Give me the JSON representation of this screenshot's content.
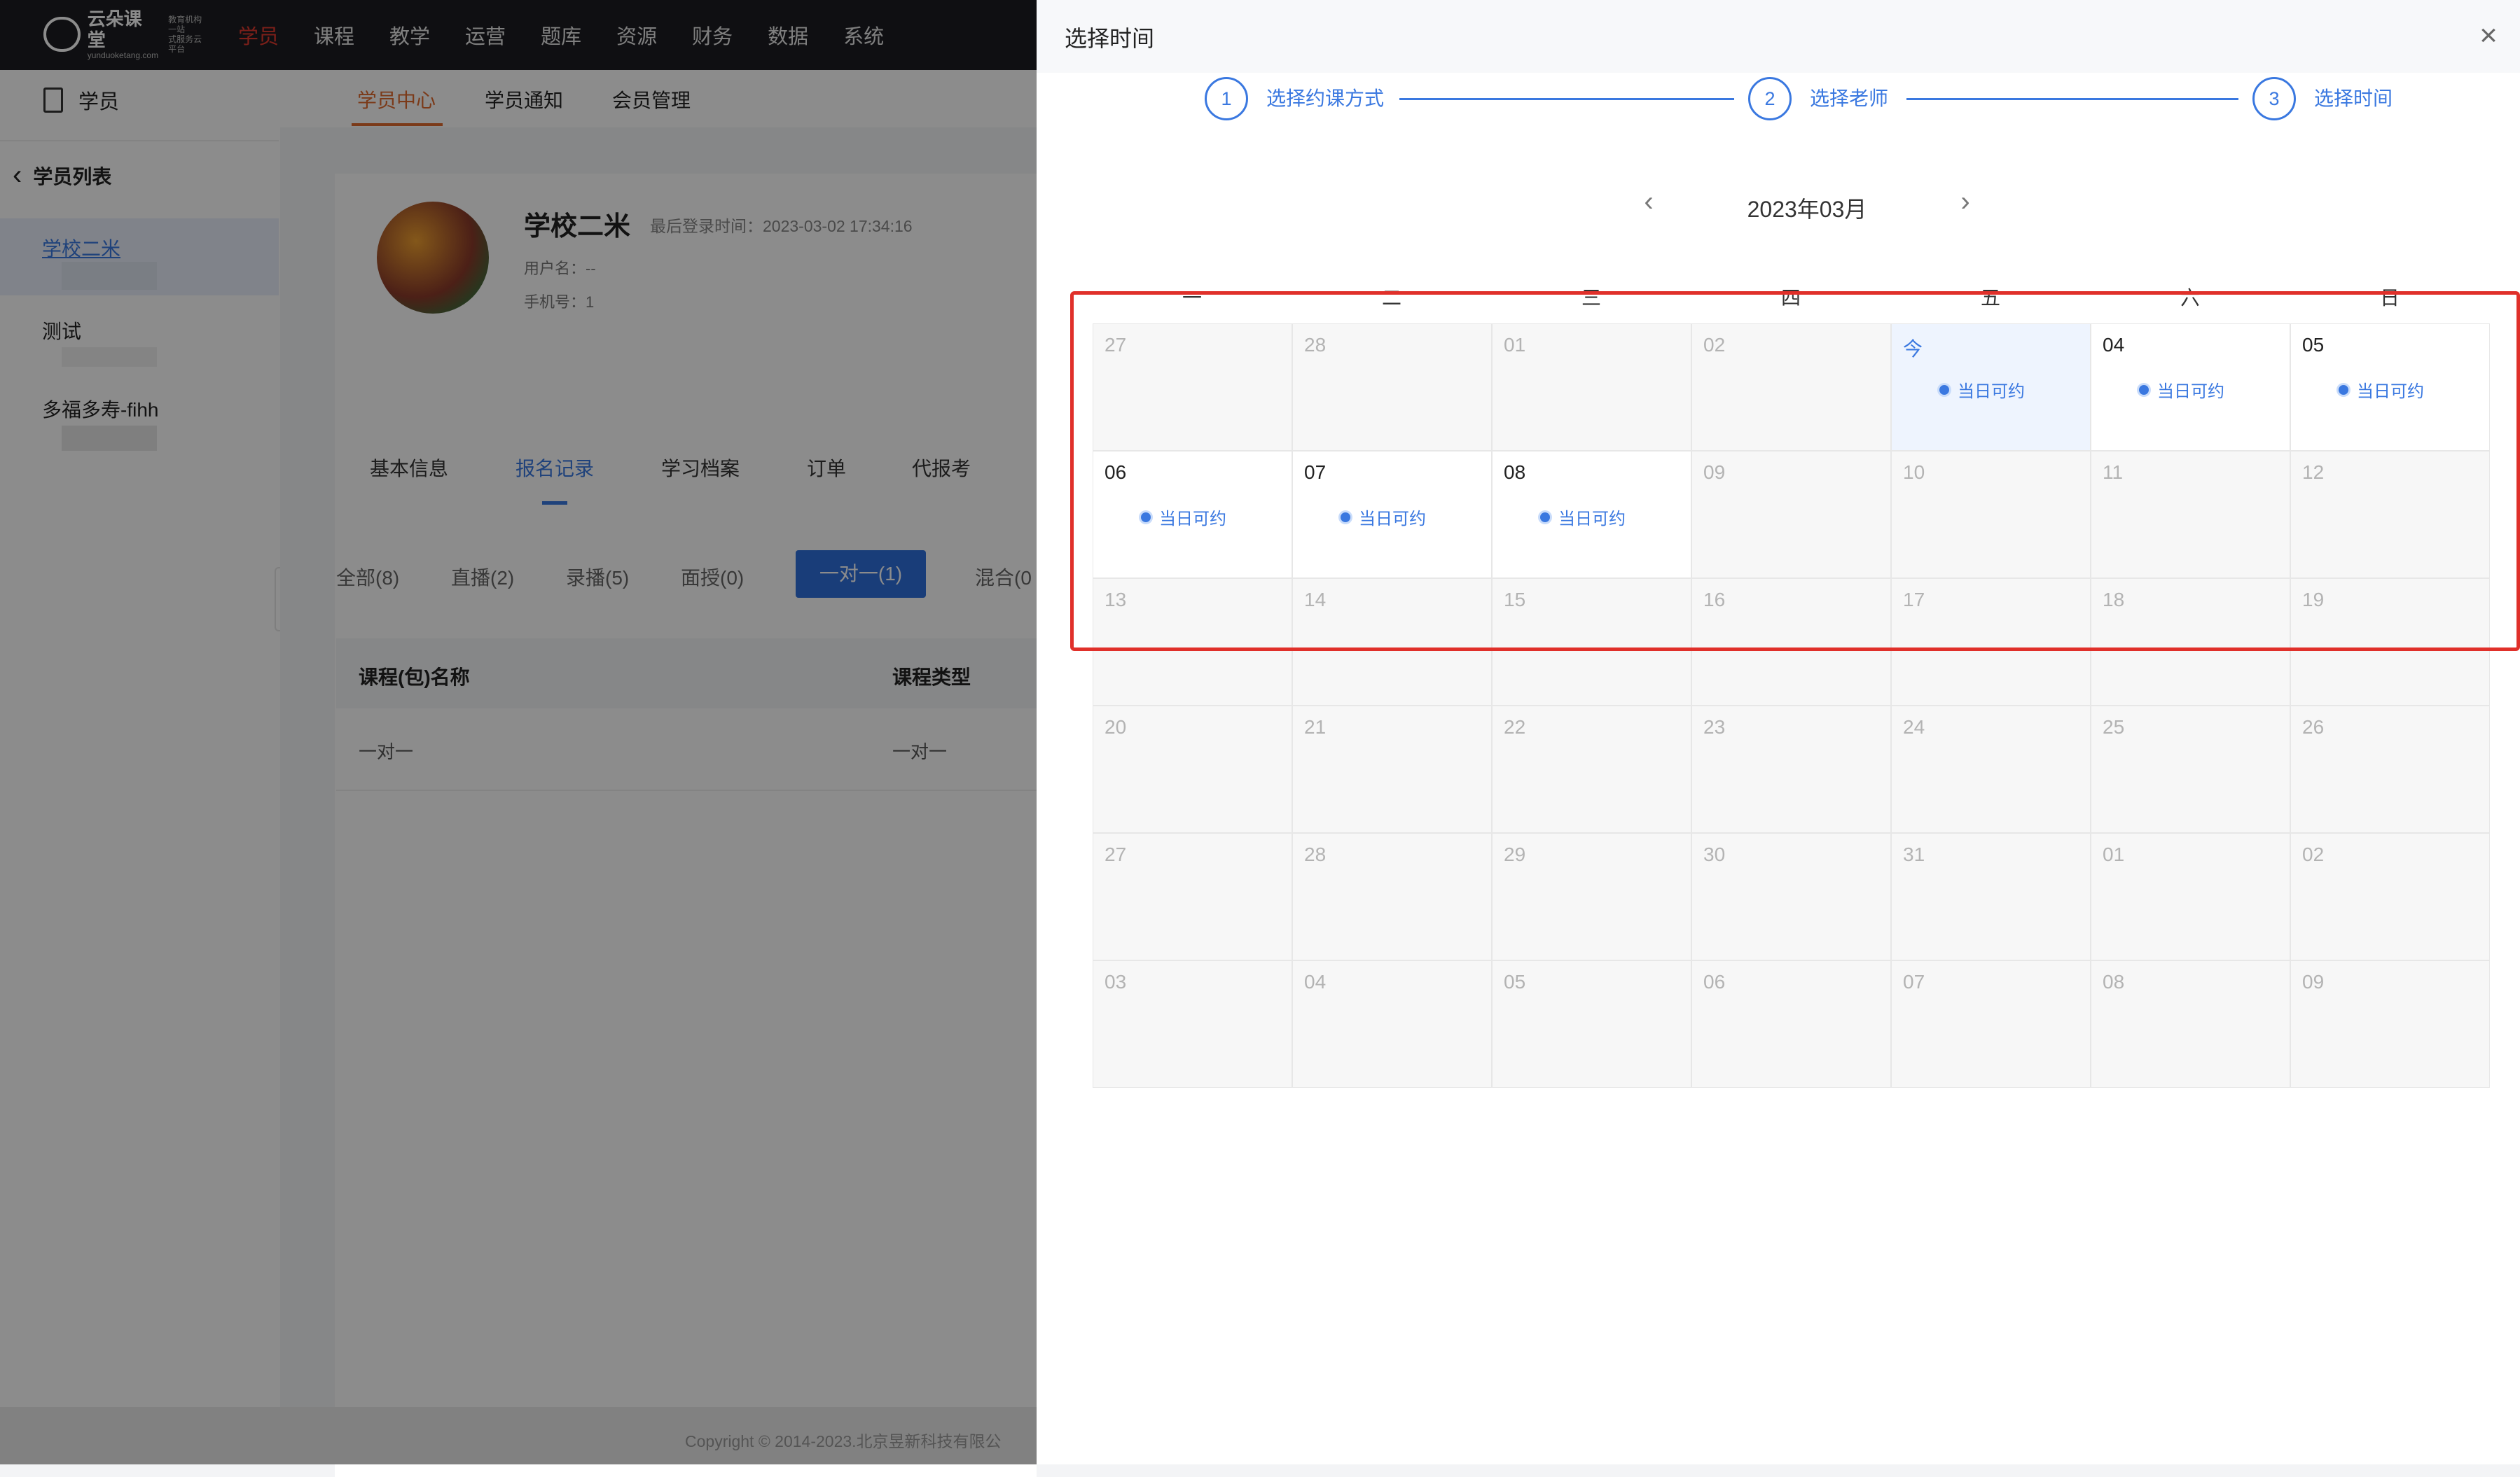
{
  "app": {
    "logo_text": "云朵课堂",
    "logo_domain": "yunduoketang.com",
    "logo_tagline_1": "教育机构一站",
    "logo_tagline_2": "式服务云平台",
    "top_nav": [
      "学员",
      "课程",
      "教学",
      "运营",
      "题库",
      "资源",
      "财务",
      "数据",
      "系统"
    ],
    "active_color": "#e23a2e"
  },
  "sidebar": {
    "module_title": "学员",
    "back_label": "学员列表",
    "students": [
      "学校二米",
      "测试",
      "多福多寿-fihh"
    ]
  },
  "main": {
    "tabs": [
      "学员中心",
      "学员通知",
      "会员管理"
    ],
    "profile": {
      "name": "学校二米",
      "last_login": "最后登录时间：2023-03-02 17:34:16",
      "username": "用户名：--",
      "phone": "手机号：1"
    },
    "sub_tabs": [
      "基本信息",
      "报名记录",
      "学习档案",
      "订单",
      "代报考"
    ],
    "filters": [
      "全部(8)",
      "直播(2)",
      "录播(5)",
      "面授(0)",
      "一对一(1)",
      "混合(0"
    ],
    "table": {
      "headers": [
        "课程(包)名称",
        "课程类型"
      ],
      "rows": [
        [
          "一对一",
          "一对一"
        ]
      ]
    },
    "copyright": "Copyright © 2014-2023.北京昱新科技有限公"
  },
  "drawer": {
    "title": "选择时间",
    "close_icon": "close-icon",
    "steps": [
      {
        "number": "1",
        "label": "选择约课方式"
      },
      {
        "number": "2",
        "label": "选择老师"
      },
      {
        "number": "3",
        "label": "选择时间"
      }
    ],
    "accent_color": "#3a78e0",
    "month_label": "2023年03月",
    "weekdays": [
      "一",
      "二",
      "三",
      "四",
      "五",
      "六",
      "日"
    ],
    "available_label": "当日可约",
    "weeks": [
      [
        {
          "d": "27"
        },
        {
          "d": "28"
        },
        {
          "d": "01"
        },
        {
          "d": "02"
        },
        {
          "d": "今",
          "today": true,
          "avail": true
        },
        {
          "d": "04",
          "cur": true,
          "avail": true
        },
        {
          "d": "05",
          "cur": true,
          "avail": true
        }
      ],
      [
        {
          "d": "06",
          "cur": true,
          "avail": true
        },
        {
          "d": "07",
          "cur": true,
          "avail": true
        },
        {
          "d": "08",
          "cur": true,
          "avail": true
        },
        {
          "d": "09"
        },
        {
          "d": "10"
        },
        {
          "d": "11"
        },
        {
          "d": "12"
        }
      ],
      [
        {
          "d": "13"
        },
        {
          "d": "14"
        },
        {
          "d": "15"
        },
        {
          "d": "16"
        },
        {
          "d": "17"
        },
        {
          "d": "18"
        },
        {
          "d": "19"
        }
      ],
      [
        {
          "d": "20"
        },
        {
          "d": "21"
        },
        {
          "d": "22"
        },
        {
          "d": "23"
        },
        {
          "d": "24"
        },
        {
          "d": "25"
        },
        {
          "d": "26"
        }
      ],
      [
        {
          "d": "27"
        },
        {
          "d": "28"
        },
        {
          "d": "29"
        },
        {
          "d": "30"
        },
        {
          "d": "31"
        },
        {
          "d": "01"
        },
        {
          "d": "02"
        }
      ],
      [
        {
          "d": "03"
        },
        {
          "d": "04"
        },
        {
          "d": "05"
        },
        {
          "d": "06"
        },
        {
          "d": "07"
        },
        {
          "d": "08"
        },
        {
          "d": "09"
        }
      ]
    ],
    "highlight_color": "#e0302a"
  }
}
